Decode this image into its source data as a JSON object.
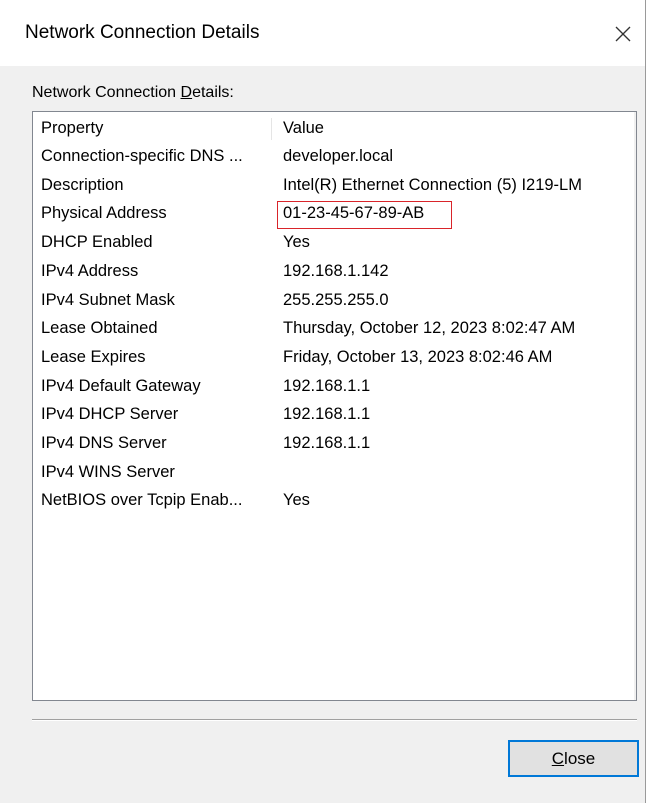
{
  "window": {
    "title": "Network Connection Details",
    "close_icon": "close-icon"
  },
  "section_label": {
    "before": "Network Connection ",
    "accel": "D",
    "after": "etails:"
  },
  "table": {
    "headers": {
      "property": "Property",
      "value": "Value"
    },
    "rows": [
      {
        "property": "Connection-specific DNS ...",
        "value": "developer.local"
      },
      {
        "property": "Description",
        "value": "Intel(R) Ethernet Connection (5) I219-LM"
      },
      {
        "property": "Physical Address",
        "value": "01-23-45-67-89-AB"
      },
      {
        "property": "DHCP Enabled",
        "value": "Yes"
      },
      {
        "property": "IPv4 Address",
        "value": "192.168.1.142"
      },
      {
        "property": "IPv4 Subnet Mask",
        "value": "255.255.255.0"
      },
      {
        "property": "Lease Obtained",
        "value": "Thursday, October 12, 2023 8:02:47 AM"
      },
      {
        "property": "Lease Expires",
        "value": "Friday, October 13, 2023 8:02:46 AM"
      },
      {
        "property": "IPv4 Default Gateway",
        "value": "192.168.1.1"
      },
      {
        "property": "IPv4 DHCP Server",
        "value": "192.168.1.1"
      },
      {
        "property": "IPv4 DNS Server",
        "value": "192.168.1.1"
      },
      {
        "property": "IPv4 WINS Server",
        "value": ""
      },
      {
        "property": "NetBIOS over Tcpip Enab...",
        "value": "Yes"
      }
    ],
    "highlight_color": "#d9242a"
  },
  "footer": {
    "close_button": {
      "accel": "C",
      "rest": "lose"
    },
    "accent": "#0078d7"
  }
}
